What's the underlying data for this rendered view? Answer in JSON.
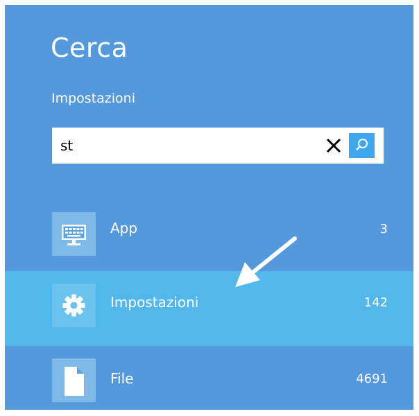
{
  "header": {
    "title": "Cerca",
    "scope": "Impostazioni"
  },
  "search": {
    "value": "st",
    "placeholder": ""
  },
  "results": [
    {
      "label": "App",
      "count": "3",
      "icon": "keyboard-monitor-icon",
      "selected": false
    },
    {
      "label": "Impostazioni",
      "count": "142",
      "icon": "gear-icon",
      "selected": true
    },
    {
      "label": "File",
      "count": "4691",
      "icon": "document-icon",
      "selected": false
    }
  ],
  "colors": {
    "panel": "#5599dd",
    "selected_row": "#52b8ec",
    "tile": "#7dbaea",
    "search_button": "#3ea7ee"
  }
}
